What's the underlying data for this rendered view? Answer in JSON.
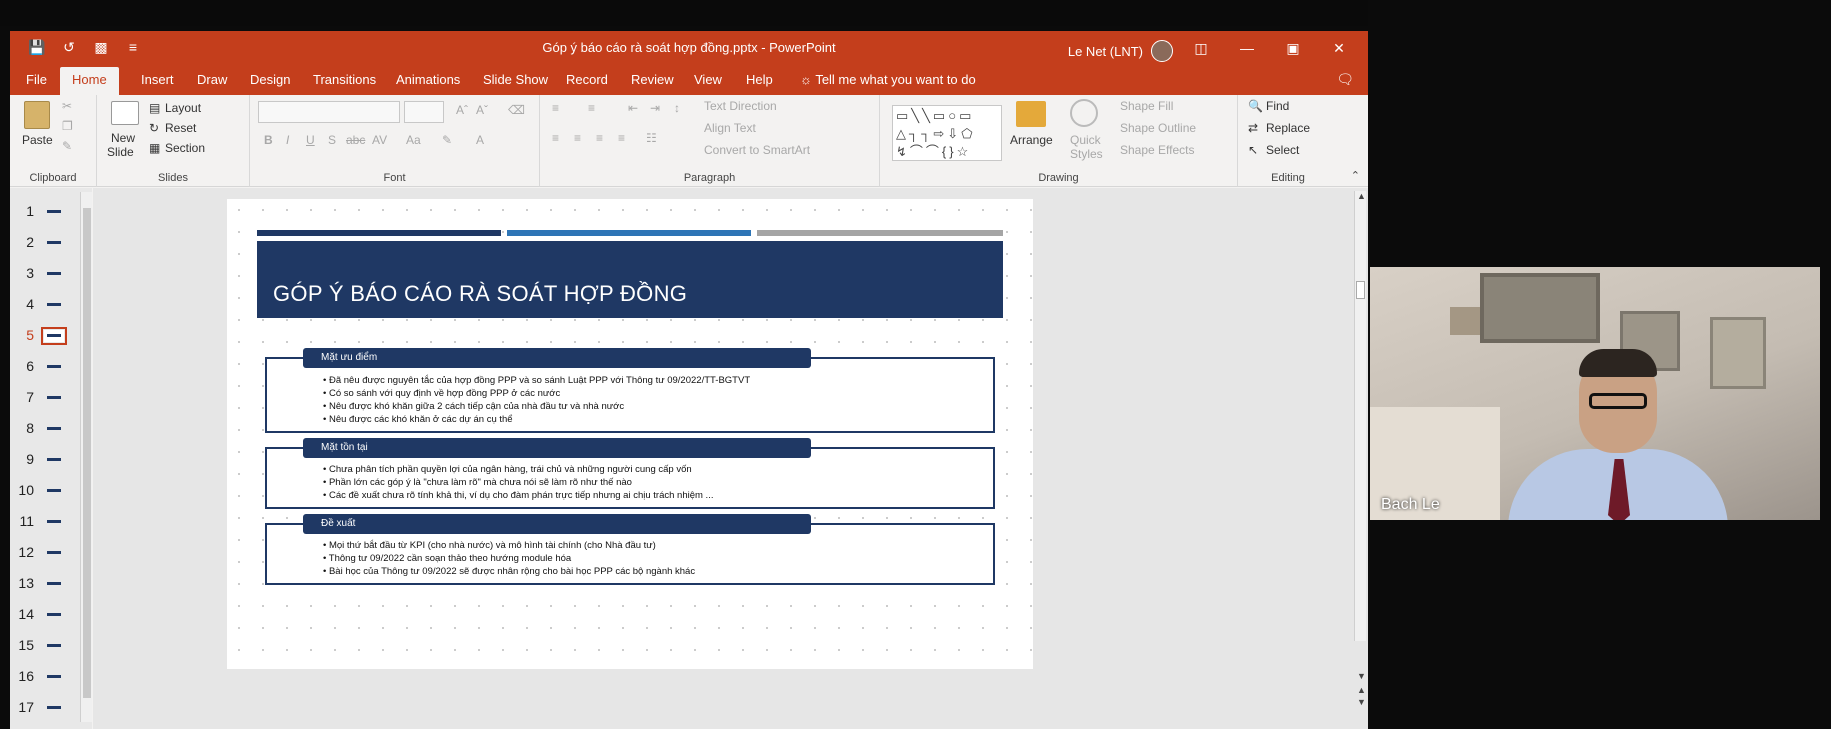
{
  "window": {
    "title": "Góp ý báo cáo rà soát hợp đồng.pptx  -  PowerPoint",
    "user": "Le  Net (LNT)",
    "accent": "#c43e1c"
  },
  "qat": [
    "save-icon",
    "undo-icon",
    "present-icon",
    "customize-icon"
  ],
  "tabs": [
    "File",
    "Home",
    "Insert",
    "Draw",
    "Design",
    "Transitions",
    "Animations",
    "Slide Show",
    "Record",
    "Review",
    "View",
    "Help"
  ],
  "tell_me": "Tell me what you want to do",
  "ribbon": {
    "clipboard": {
      "label": "Clipboard",
      "paste": "Paste"
    },
    "slides": {
      "label": "Slides",
      "new_slide": "New",
      "new_slide2": "Slide",
      "layout": "Layout",
      "reset": "Reset",
      "section": "Section"
    },
    "font": {
      "label": "Font",
      "bold": "B",
      "italic": "I",
      "underline": "U",
      "strike": "S",
      "abc": "abc",
      "av": "AV",
      "aa": "Aa"
    },
    "paragraph": {
      "label": "Paragraph",
      "text_direction": "Text Direction",
      "align_text": "Align Text",
      "smartart": "Convert to SmartArt"
    },
    "drawing": {
      "label": "Drawing",
      "arrange": "Arrange",
      "quick": "Quick",
      "styles": "Styles",
      "shape_fill": "Shape Fill",
      "shape_outline": "Shape Outline",
      "shape_effects": "Shape Effects"
    },
    "editing": {
      "label": "Editing",
      "find": "Find",
      "replace": "Replace",
      "select": "Select"
    }
  },
  "thumbnails": [
    "1",
    "2",
    "3",
    "4",
    "5",
    "6",
    "7",
    "8",
    "9",
    "10",
    "11",
    "12",
    "13",
    "14",
    "15",
    "16",
    "17"
  ],
  "active_slide": "5",
  "slide": {
    "title": "GÓP Ý BÁO CÁO RÀ SOÁT HỢP ĐỒNG",
    "sections": [
      {
        "heading": "Mặt ưu điểm",
        "bullets": [
          "• Đã nêu được nguyên tắc của hợp đồng PPP và so sánh Luật PPP với Thông tư 09/2022/TT-BGTVT",
          "• Có so sánh với quy định về hợp đồng PPP ở các nước",
          "• Nêu được khó khăn giữa 2 cách tiếp cận của nhà đầu tư và nhà nước",
          "• Nêu được các khó khăn ở các dự án cụ thể"
        ]
      },
      {
        "heading": "Mặt tồn tại",
        "bullets": [
          "• Chưa phân tích phần quyền lợi của ngân hàng, trái chủ và những người cung cấp vốn",
          "• Phần lớn các góp ý là \"chưa làm rõ\" mà chưa nói sẽ làm rõ như thế nào",
          "• Các đề xuất chưa rõ tính khả thi, ví dụ cho đàm phán trực tiếp nhưng ai chịu trách nhiệm ..."
        ]
      },
      {
        "heading": "Đề xuất",
        "bullets": [
          "• Mọi thứ bắt đầu từ KPI (cho nhà nước) và mô hình tài chính (cho Nhà đầu tư)",
          "• Thông tư 09/2022 cần soạn thảo theo hướng module hóa",
          "• Bài học của Thông tư 09/2022 sẽ được nhân rộng cho bài học PPP các bộ ngành khác"
        ]
      }
    ],
    "colors": {
      "navy": "#1f3864",
      "light_blue": "#2e75b6",
      "gray": "#a5a5a5"
    }
  },
  "video": {
    "name": "Bach Le"
  }
}
